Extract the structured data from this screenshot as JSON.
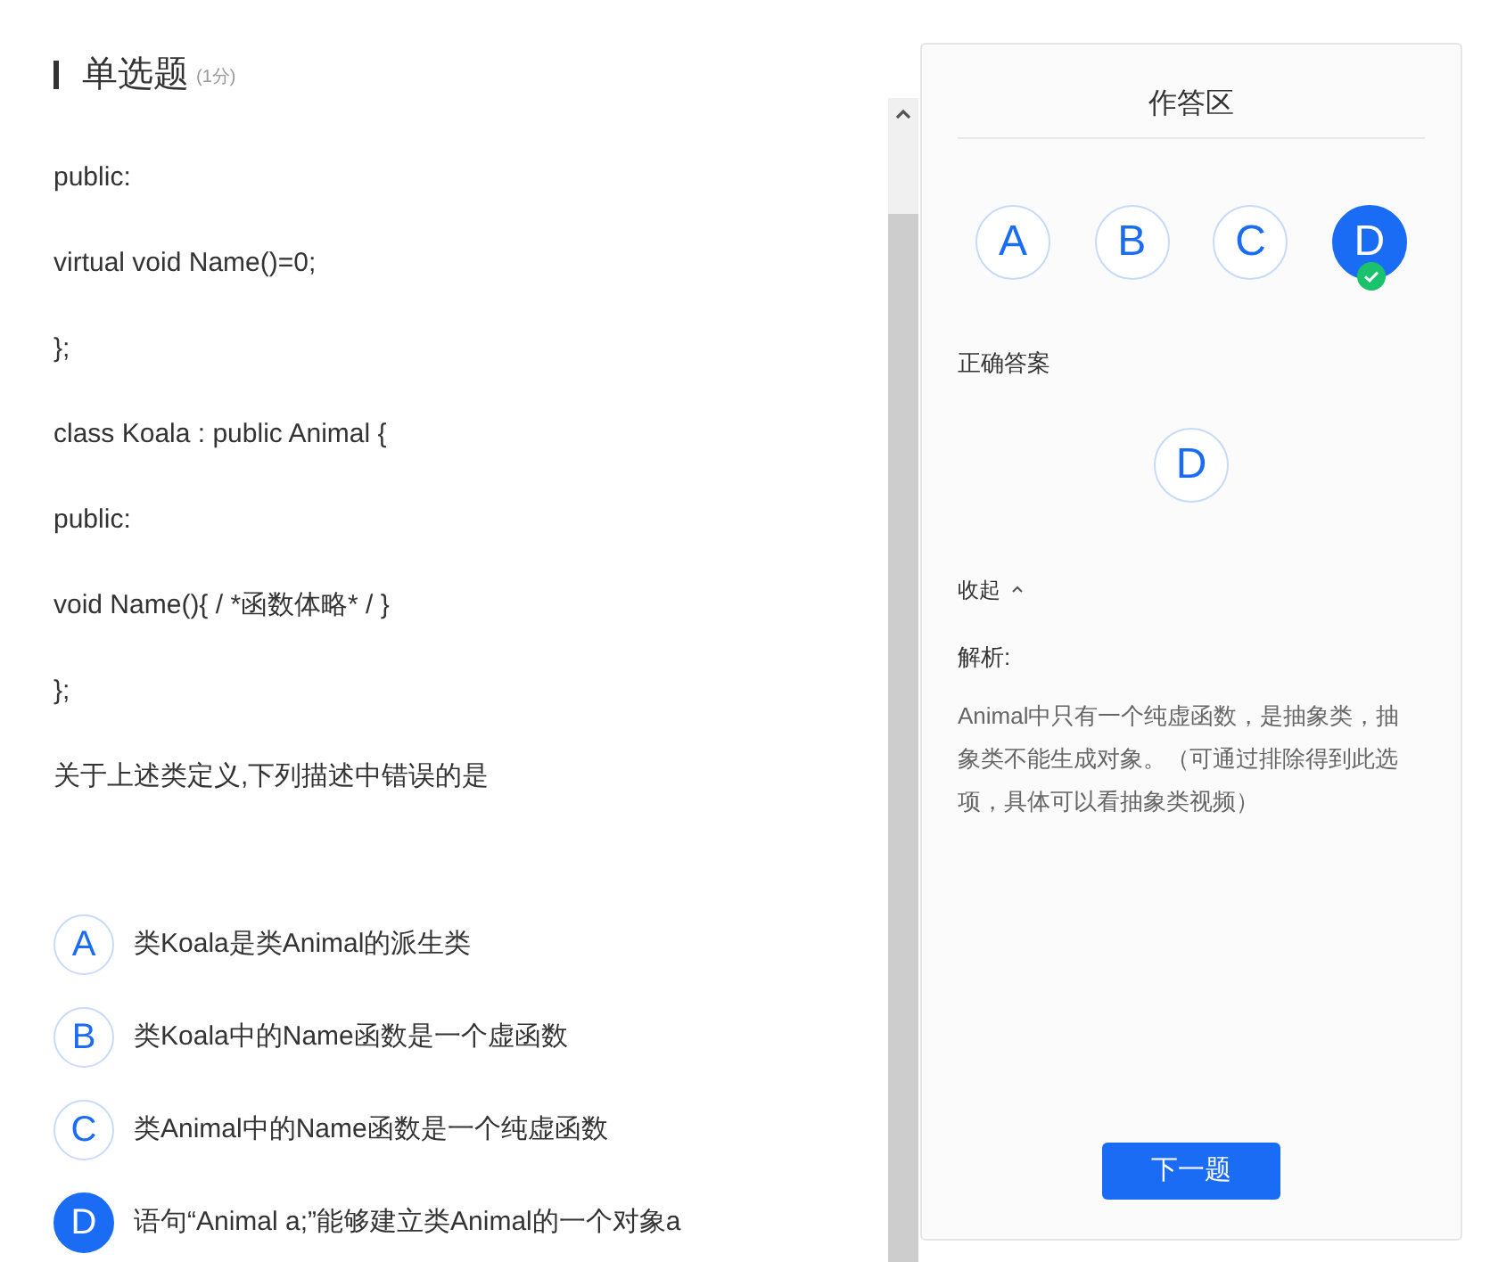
{
  "question": {
    "type": "单选题",
    "score": "(1分)",
    "code_lines": [
      "public:",
      "virtual void Name()=0;",
      "};",
      "class Koala : public Animal {",
      "public:",
      "void Name(){ / *函数体略* / }",
      "};"
    ],
    "prompt": "关于上述类定义,下列描述中错误的是",
    "options": [
      {
        "letter": "A",
        "text": "类Koala是类Animal的派生类",
        "selected": false
      },
      {
        "letter": "B",
        "text": "类Koala中的Name函数是一个虚函数",
        "selected": false
      },
      {
        "letter": "C",
        "text": "类Animal中的Name函数是一个纯虚函数",
        "selected": false
      },
      {
        "letter": "D",
        "text": "语句“Animal a;”能够建立类Animal的一个对象a",
        "selected": true
      }
    ]
  },
  "answer_panel": {
    "title": "作答区",
    "choices": [
      {
        "letter": "A",
        "selected": false,
        "correct": false
      },
      {
        "letter": "B",
        "selected": false,
        "correct": false
      },
      {
        "letter": "C",
        "selected": false,
        "correct": false
      },
      {
        "letter": "D",
        "selected": true,
        "correct": true
      }
    ],
    "correct_answer_label": "正确答案",
    "correct_answer": "D",
    "collapse_label": "收起",
    "expanded": true,
    "analysis_label": "解析:",
    "analysis": "Animal中只有一个纯虚函数，是抽象类，抽象类不能生成对象。（可通过排除得到此选项，具体可以看抽象类视频）",
    "next_button": "下一题"
  }
}
